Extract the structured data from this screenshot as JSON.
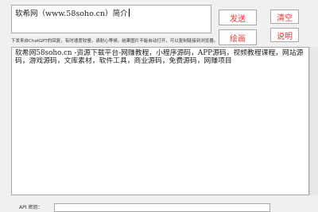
{
  "prompt": {
    "value": "软希网（www.58soho.cn）简介"
  },
  "buttons": {
    "send": "发送",
    "draw": "绘画",
    "clear": "清空",
    "help": "说明"
  },
  "hint": "下发来自ChatGPT的回复，有时速度较慢，请耐心等候。结果图片不能自动打开，可以复制链接到浏览器。",
  "output": {
    "text": "软希网58soho.cn -资源下载平台-网赚教程，小程序源码，APP源码，视频教程课程，网站源码，游戏源码，文库素材，软件工具，商业源码，免费源码，网赚项目"
  },
  "api": {
    "label": "API 密钥：",
    "value": ""
  },
  "colors": {
    "button_text": "#e23a3a",
    "background": "#f0f0f0"
  }
}
